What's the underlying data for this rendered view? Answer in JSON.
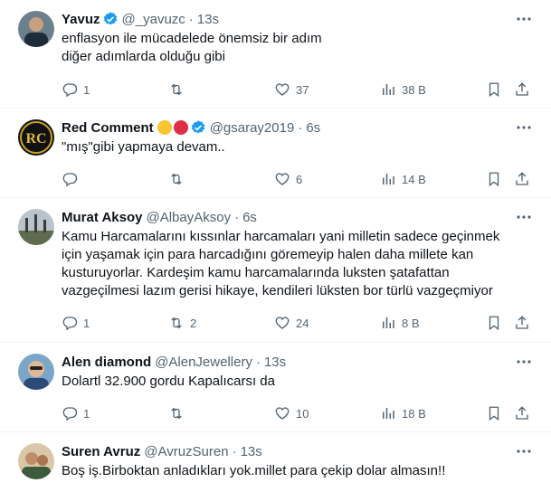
{
  "tweets": [
    {
      "name": "Yavuz",
      "handle": "@_yavuzc",
      "time": "13s",
      "text": "enflasyon ile mücadelede önemsiz bir adım\ndiğer adımlarda olduğu gibi",
      "replies": "1",
      "retweets": "",
      "likes": "37",
      "views": "38 B"
    },
    {
      "name": "Red Comment",
      "handle": "@gsaray2019",
      "time": "6s",
      "text": "\"mış\"gibi yapmaya devam..",
      "replies": "",
      "retweets": "",
      "likes": "6",
      "views": "14 B",
      "avatar_text": "RC"
    },
    {
      "name": "Murat Aksoy",
      "handle": "@AlbayAksoy",
      "time": "6s",
      "text": "Kamu Harcamalarını kıssınlar harcamaları yani milletin sadece geçinmek\niçin yaşamak için para harcadığını göremeyip halen daha millete kan\nkusturuyorlar. Kardeşim kamu harcamalarında luksten şatafattan\nvazgeçilmesi lazım gerisi hikaye, kendileri lüksten bor türlü vazgeçmiyor",
      "replies": "1",
      "retweets": "2",
      "likes": "24",
      "views": "8 B"
    },
    {
      "name": "Alen diamond",
      "handle": "@AlenJewellery",
      "time": "13s",
      "text": "Dolartl 32.900 gordu Kapalıcarsı da",
      "replies": "1",
      "retweets": "",
      "likes": "10",
      "views": "18 B"
    },
    {
      "name": "Suren Avruz",
      "handle": "@AvruzSuren",
      "time": "13s",
      "text": "Boş iş.Birboktan anladıkları yok.millet para çekip dolar almasın!!",
      "replies": "",
      "retweets": "",
      "likes": "",
      "views": ""
    }
  ],
  "colors": {
    "text": "#0f1419",
    "muted": "#536471",
    "verified": "#1d9bf0",
    "divider": "#eff3f4"
  },
  "icons": [
    "verified-badge-icon",
    "more-icon",
    "reply-icon",
    "retweet-icon",
    "like-icon",
    "views-icon",
    "bookmark-icon",
    "share-icon"
  ]
}
